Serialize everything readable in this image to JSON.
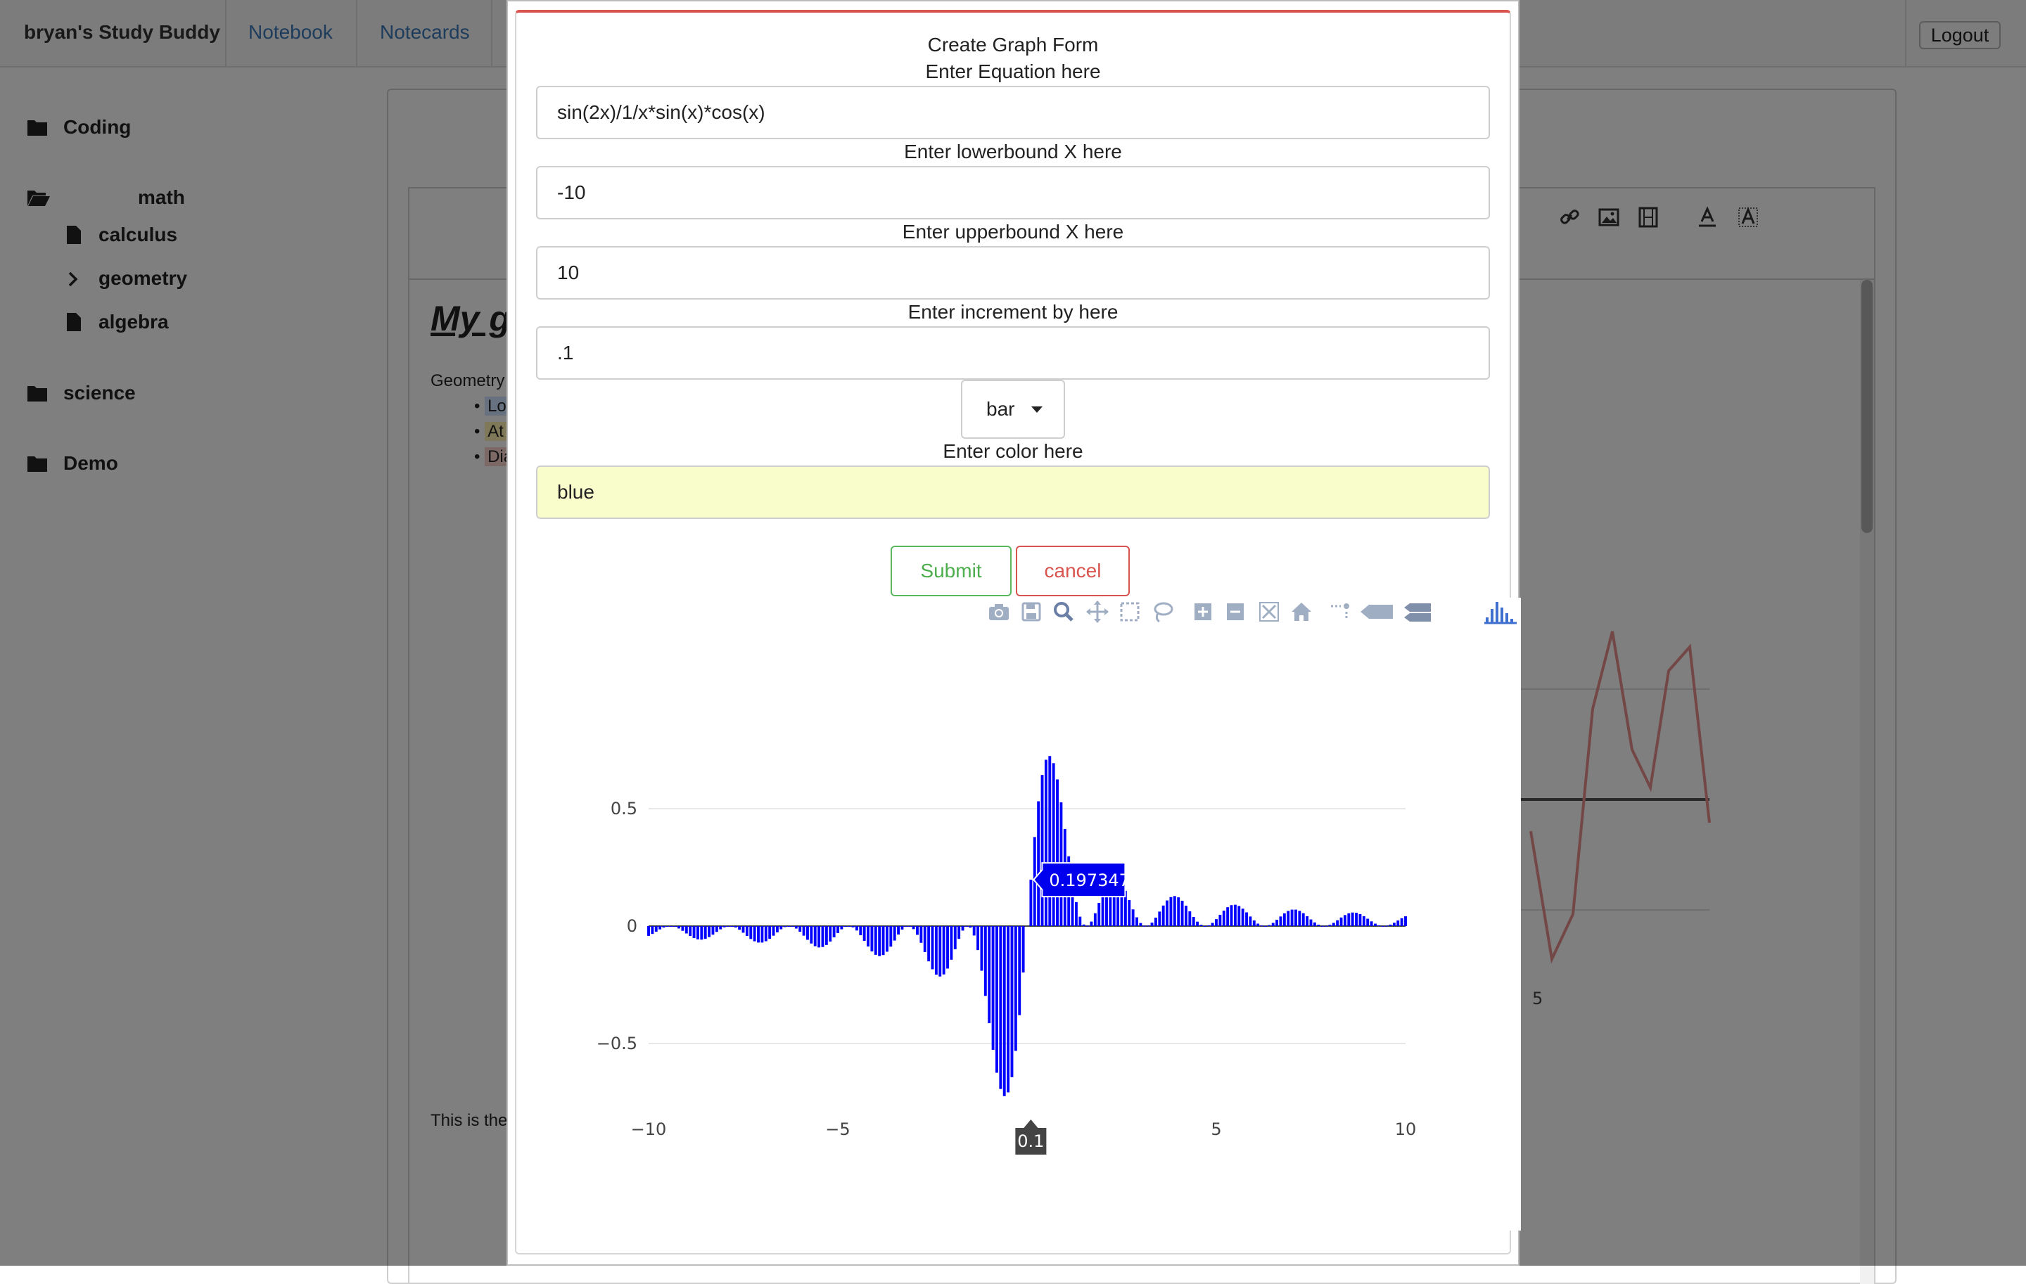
{
  "navbar": {
    "brand": "bryan's Study Buddy",
    "links": [
      "Notebook",
      "Notecards"
    ],
    "logout": "Logout"
  },
  "sidebar": {
    "items": [
      {
        "label": "Coding",
        "icon": "folder-icon"
      },
      {
        "label": "math",
        "icon": "folder-open-icon"
      },
      {
        "label": "calculus",
        "icon": "file-icon"
      },
      {
        "label": "geometry",
        "icon": "chevron-right-icon"
      },
      {
        "label": "algebra",
        "icon": "file-icon"
      },
      {
        "label": "science",
        "icon": "folder-icon"
      },
      {
        "label": "Demo",
        "icon": "folder-icon"
      }
    ]
  },
  "editor": {
    "title": "My g",
    "line1": "Geometry",
    "bullets": [
      "Lo",
      "At",
      "Dia"
    ],
    "footer_text": "This is the",
    "tools": [
      "link-icon",
      "image-icon",
      "film-icon",
      "font-color-icon",
      "font-background-icon"
    ]
  },
  "form": {
    "title": "Create Graph Form",
    "equation_label": "Enter Equation here",
    "equation_value": "sin(2x)/1/x*sin(x)*cos(x)",
    "lower_label": "Enter lowerbound X here",
    "lower_value": "-10",
    "upper_label": "Enter upperbound X here",
    "upper_value": "10",
    "increment_label": "Enter increment by here",
    "increment_value": ".1",
    "graph_type": "bar",
    "color_label": "Enter color here",
    "color_value": "blue",
    "submit": "Submit",
    "cancel": "cancel"
  },
  "modebar": [
    "camera-icon",
    "save-icon",
    "zoom-icon",
    "pan-icon",
    "box-select-icon",
    "lasso-icon",
    "zoom-in-icon",
    "zoom-out-icon",
    "autoscale-icon",
    "reset-axes-icon",
    "spike-lines-icon",
    "hover-closest-icon",
    "hover-compare-icon",
    "plotly-logo-icon"
  ],
  "chart_data": {
    "type": "bar",
    "title": "",
    "xlabel": "",
    "ylabel": "",
    "xlim": [
      -10,
      10
    ],
    "ylim": [
      -0.8,
      0.8
    ],
    "x_ticks": [
      "−10",
      "−5",
      "5",
      "10"
    ],
    "y_ticks": [
      "0.5",
      "0",
      "−0.5"
    ],
    "grid": true,
    "color": "#0000ff",
    "equation": "y = sin(2x)/x * sin(x) * cos(x)",
    "x_start": -10,
    "x_end": 10,
    "x_step": 0.1,
    "hover": {
      "x": "0.1",
      "y": "0.1973475"
    }
  },
  "colors": {
    "bar": "#0000ff",
    "danger": "#d9534f",
    "success": "#5cb85c",
    "input_highlight": "#f9fccb"
  }
}
